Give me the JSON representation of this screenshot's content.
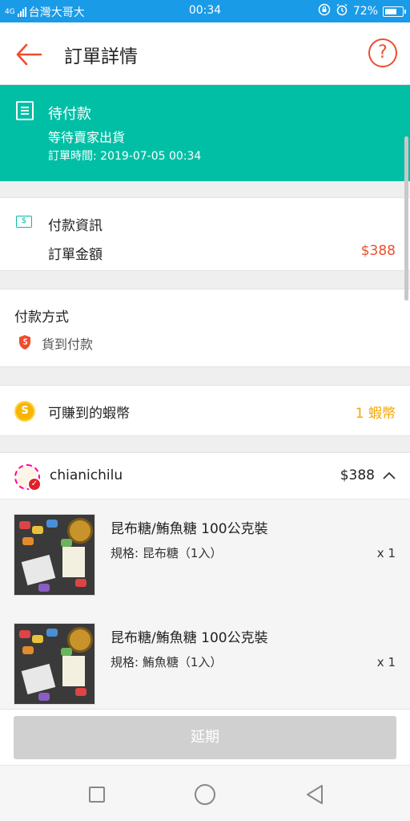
{
  "status_bar": {
    "network": "4G",
    "carrier": "台灣大哥大",
    "time": "00:34",
    "battery": "72%",
    "battery_level": 0.72
  },
  "header": {
    "title": "訂單詳情",
    "help_symbol": "?"
  },
  "order_status": {
    "title": "待付款",
    "subtitle": "等待賣家出貨",
    "order_time": "訂單時間: 2019-07-05 00:34"
  },
  "payment_info": {
    "icon_symbol": "$",
    "title": "付款資訊",
    "amount_label": "訂單金額",
    "amount_value": "$388"
  },
  "payment_method": {
    "title": "付款方式",
    "method": "貨到付款"
  },
  "coins": {
    "icon_symbol": "S",
    "label": "可賺到的蝦幣",
    "value": "1 蝦幣"
  },
  "shop": {
    "name": "chianichilu",
    "total": "$388",
    "products": [
      {
        "name": "昆布糖/鮪魚糖 100公克裝",
        "spec": "規格: 昆布糖（1入）",
        "qty": "x 1"
      },
      {
        "name": "昆布糖/鮪魚糖 100公克裝",
        "spec": "規格: 鮪魚糖（1入）",
        "qty": "x 1"
      }
    ]
  },
  "footer": {
    "extend_label": "延期"
  },
  "colors": {
    "status_bar": "#1a9be8",
    "teal": "#00bfa5",
    "shopee_orange": "#ee4d2d",
    "coin_gold": "#f5a700"
  }
}
